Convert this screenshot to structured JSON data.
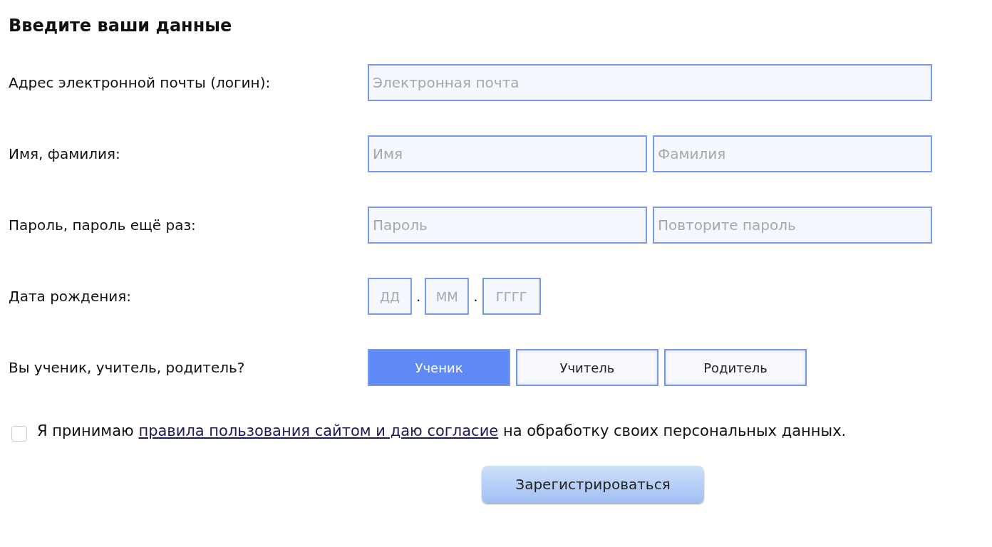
{
  "heading": "Введите ваши данные",
  "rows": [
    {
      "kind": "fields",
      "label": "Адрес электронной почты (логин):",
      "fields": [
        {
          "placeholder": "Электронная почта"
        }
      ]
    },
    {
      "kind": "fields",
      "label": "Имя, фамилия:",
      "fields": [
        {
          "placeholder": "Имя"
        },
        {
          "placeholder": "Фамилия"
        }
      ]
    },
    {
      "kind": "fields",
      "label": "Пароль, пароль ещё раз:",
      "fields": [
        {
          "placeholder": "Пароль"
        },
        {
          "placeholder": "Повторите пароль"
        }
      ]
    },
    {
      "kind": "date",
      "label": "Дата рождения:",
      "fields": [
        {
          "placeholder": "ДД"
        },
        {
          "placeholder": "ММ"
        },
        {
          "placeholder": "ГГГГ"
        }
      ],
      "separator": "."
    },
    {
      "kind": "roles",
      "label": "Вы ученик, учитель, родитель?",
      "options": [
        {
          "label": "Ученик",
          "selected": true
        },
        {
          "label": "Учитель",
          "selected": false
        },
        {
          "label": "Родитель",
          "selected": false
        }
      ]
    }
  ],
  "consent": {
    "checked": false,
    "before": "Я принимаю ",
    "link": "правила пользования сайтом и даю согласие",
    "after": " на обработку своих персональных данных."
  },
  "submit": "Зарегистрироваться"
}
